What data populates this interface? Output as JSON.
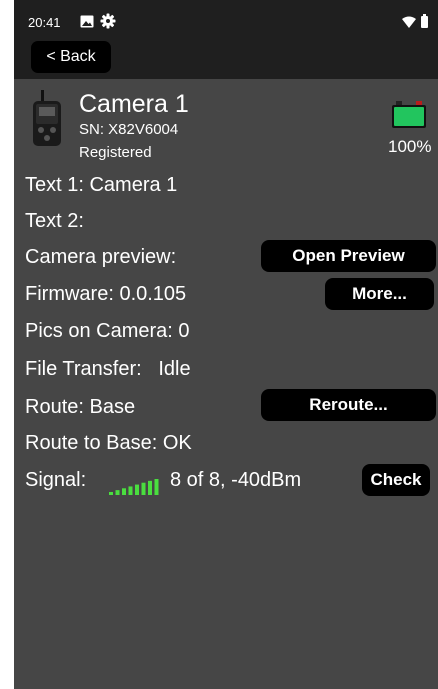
{
  "status_bar": {
    "time": "20:41",
    "icons": [
      "image-icon",
      "gear-icon",
      "wifi-icon",
      "battery-icon"
    ]
  },
  "nav": {
    "back_label": "< Back"
  },
  "camera": {
    "name": "Camera 1",
    "serial": "SN: X82V6004",
    "status": "Registered",
    "battery_percent": "100%",
    "battery_color": "#22c55e"
  },
  "details": {
    "text1": "Text 1: Camera 1",
    "text2": "Text 2:",
    "preview_label": "Camera preview:",
    "preview_button": "Open Preview",
    "firmware": "Firmware: 0.0.105",
    "more_button": "More...",
    "pics": "Pics on Camera: 0",
    "file_transfer": "File Transfer:   Idle",
    "route": "Route: Base",
    "reroute_button": "Reroute...",
    "route_to_base": "Route to Base: OK",
    "signal_label": "Signal:",
    "signal_value": "8 of 8, -40dBm",
    "signal_bars_filled": 8,
    "signal_bars_total": 8,
    "signal_color": "#4ade3f",
    "check_button": "Check"
  },
  "colors": {
    "background": "#464646",
    "top_bar": "#1f1f1f",
    "button": "#000000"
  }
}
